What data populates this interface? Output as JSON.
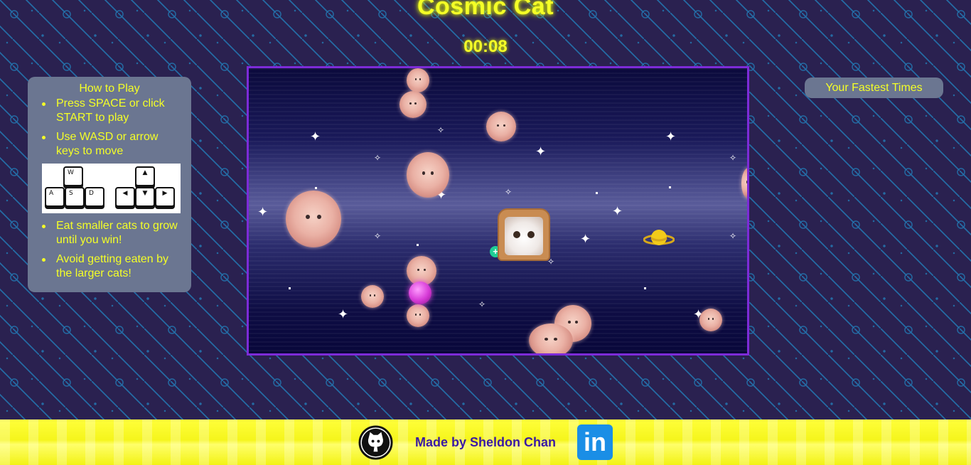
{
  "header": {
    "title": "Cosmic Cat",
    "timer": "00:08"
  },
  "how_to_play": {
    "title": "How to Play",
    "items": [
      "Press SPACE or click START to play",
      "Use WASD or arrow keys to move",
      "Eat smaller cats to grow until you win!",
      "Avoid getting eaten by the larger cats!"
    ],
    "keys": {
      "w": "W",
      "a": "A",
      "s": "S",
      "d": "D",
      "up": "▲",
      "left": "◀",
      "down": "▼",
      "right": "▶"
    }
  },
  "fastest_times": {
    "title": "Your Fastest Times"
  },
  "footer": {
    "made_by": "Made by Sheldon Chan",
    "github_icon": "github-icon",
    "linkedin_icon": "linkedin-icon",
    "linkedin_text": "in"
  },
  "colors": {
    "background": "#2a2250",
    "pattern": "#1fa6e8",
    "accent_yellow": "#f4ff27",
    "panel": "#6b7691",
    "game_border": "#7d2bd8",
    "footer_yellow": "#ffff3a",
    "footer_text": "#3b1aa3",
    "linkedin_blue": "#1a8ee6"
  }
}
